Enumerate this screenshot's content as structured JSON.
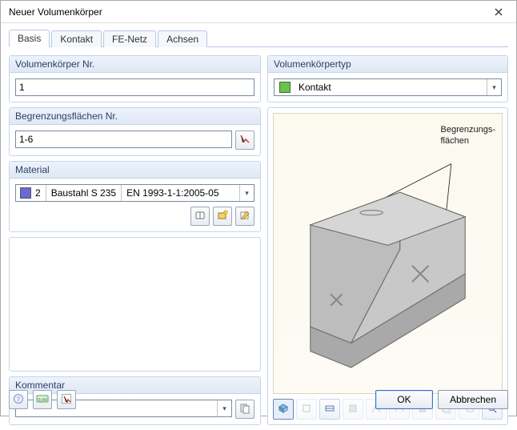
{
  "window": {
    "title": "Neuer Volumenkörper"
  },
  "tabs": [
    {
      "label": "Basis",
      "active": true
    },
    {
      "label": "Kontakt",
      "active": false
    },
    {
      "label": "FE-Netz",
      "active": false
    },
    {
      "label": "Achsen",
      "active": false
    }
  ],
  "left": {
    "solid_no": {
      "header": "Volumenkörper Nr.",
      "value": "1"
    },
    "boundary_surfaces": {
      "header": "Begrenzungsflächen Nr.",
      "value": "1-6",
      "pick_icon": "pick-surfaces-icon"
    },
    "material": {
      "header": "Material",
      "swatch_color": "#6a6ad6",
      "number": "2",
      "name": "Baustahl S 235",
      "standard": "EN 1993-1-1:2005-05",
      "buttons": {
        "library": "material-library-icon",
        "new": "new-material-icon",
        "edit": "edit-material-icon"
      }
    },
    "comment": {
      "header": "Kommentar",
      "value": "",
      "pick_icon": "comment-pick-icon"
    }
  },
  "right": {
    "type": {
      "header": "Volumenkörpertyp",
      "swatch_color": "#6ac14b",
      "selected": "Kontakt"
    },
    "preview": {
      "label_line1": "Begrenzungs-",
      "label_line2": "flächen"
    },
    "toolbar": [
      {
        "name": "view-iso-icon",
        "enabled": true,
        "selected": true
      },
      {
        "name": "view-x-icon",
        "enabled": false,
        "selected": false
      },
      {
        "name": "view-y-icon",
        "enabled": true,
        "selected": false
      },
      {
        "name": "view-z-icon",
        "enabled": false,
        "selected": false
      },
      {
        "name": "view-xy-icon",
        "enabled": false,
        "selected": false
      },
      {
        "name": "show-wire-icon",
        "enabled": false,
        "selected": false
      },
      {
        "name": "show-solid-icon",
        "enabled": false,
        "selected": false
      },
      {
        "name": "show-trans-icon",
        "enabled": false,
        "selected": false
      },
      {
        "name": "show-box-icon",
        "enabled": false,
        "selected": false
      },
      {
        "name": "zoom-fit-icon",
        "enabled": true,
        "selected": false
      }
    ]
  },
  "footer": {
    "help_icon": "help-icon",
    "units_icon": "units-icon",
    "pick_icon": "pick-icon",
    "ok": "OK",
    "cancel": "Abbrechen"
  }
}
